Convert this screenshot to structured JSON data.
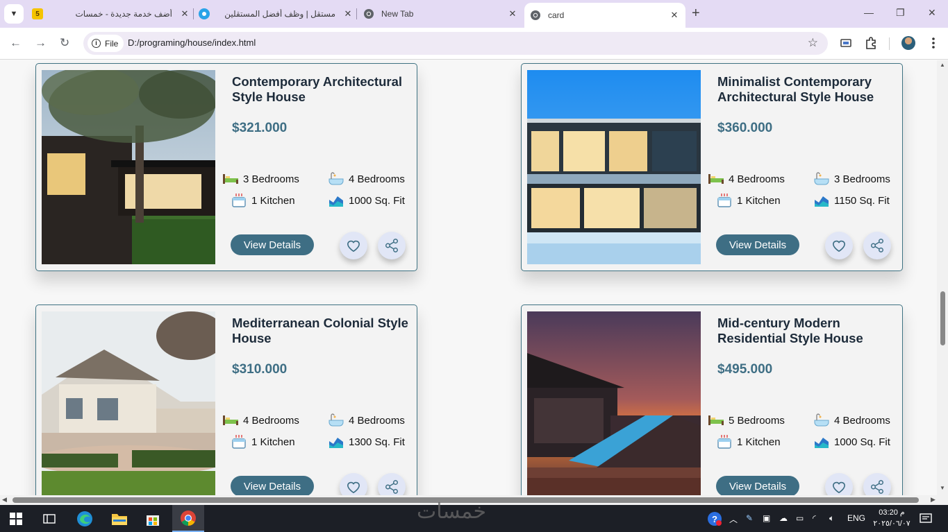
{
  "browser": {
    "tabs": [
      {
        "title": "أضف خدمة جديدة - خمسات",
        "favicon_text": "5",
        "active": false
      },
      {
        "title": "مستقل | وظف أفضل المستقلين",
        "active": false
      },
      {
        "title": "New Tab",
        "active": false
      },
      {
        "title": "card",
        "active": true
      }
    ],
    "chip_label": "File",
    "url": "D:/programing/house/index.html",
    "tab_close": "✕",
    "new_tab": "+"
  },
  "listings": [
    {
      "title": "Contemporary Architectural Style House",
      "price": "$321.000",
      "bedrooms": "3 Bedrooms",
      "baths": "4 Bedrooms",
      "kitchen": "1 Kitchen",
      "area": "1000 Sq. Fit",
      "cta": "View Details"
    },
    {
      "title": "Minimalist Contemporary Architectural Style House",
      "price": "$360.000",
      "bedrooms": "4 Bedrooms",
      "baths": "3 Bedrooms",
      "kitchen": "1 Kitchen",
      "area": "1150 Sq. Fit",
      "cta": "View Details"
    },
    {
      "title": "Mediterranean Colonial Style House",
      "price": "$310.000",
      "bedrooms": "4 Bedrooms",
      "baths": "4 Bedrooms",
      "kitchen": "1 Kitchen",
      "area": "1300 Sq. Fit",
      "cta": "View Details"
    },
    {
      "title": "Mid-century Modern Residential Style House",
      "price": "$495.000",
      "bedrooms": "5 Bedrooms",
      "baths": "4 Bedrooms",
      "kitchen": "1 Kitchen",
      "area": "1000 Sq. Fit",
      "cta": "View Details"
    }
  ],
  "taskbar": {
    "watermark": "خمسات",
    "language": "ENG",
    "time": "03:20 م",
    "date": "٢٠٢٥/٠٦/٠٧"
  },
  "colors": {
    "accent": "#3e6e84",
    "card_border": "#3e7282",
    "tab_strip": "#e4dbf4"
  }
}
